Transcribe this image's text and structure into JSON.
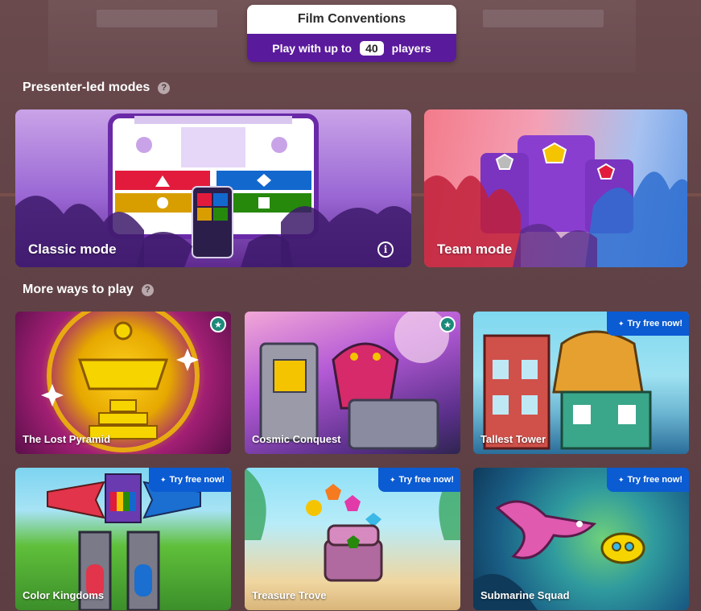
{
  "header": {
    "title": "Film Conventions",
    "sub_prefix": "Play with up to",
    "player_count": "40",
    "sub_suffix": "players"
  },
  "sections": {
    "presenter": {
      "title": "Presenter-led modes",
      "help": "?"
    },
    "more": {
      "title": "More ways to play",
      "help": "?"
    }
  },
  "modes": [
    {
      "label": "Classic mode",
      "info": "i"
    },
    {
      "label": "Team mode"
    }
  ],
  "games": [
    {
      "label": "The Lost Pyramid",
      "badge": "★"
    },
    {
      "label": "Cosmic Conquest",
      "badge": "★"
    },
    {
      "label": "Tallest Tower",
      "badge": "Try free now!"
    },
    {
      "label": "Color Kingdoms",
      "badge": "Try free now!"
    },
    {
      "label": "Treasure Trove",
      "badge": "Try free now!"
    },
    {
      "label": "Submarine Squad",
      "badge": "Try free now!"
    }
  ],
  "icons": {
    "sparkle": "✦"
  },
  "colors": {
    "accent_purple": "#5a1a9c",
    "try_blue": "#0b5bd3",
    "star_teal": "#1d8a7a"
  }
}
